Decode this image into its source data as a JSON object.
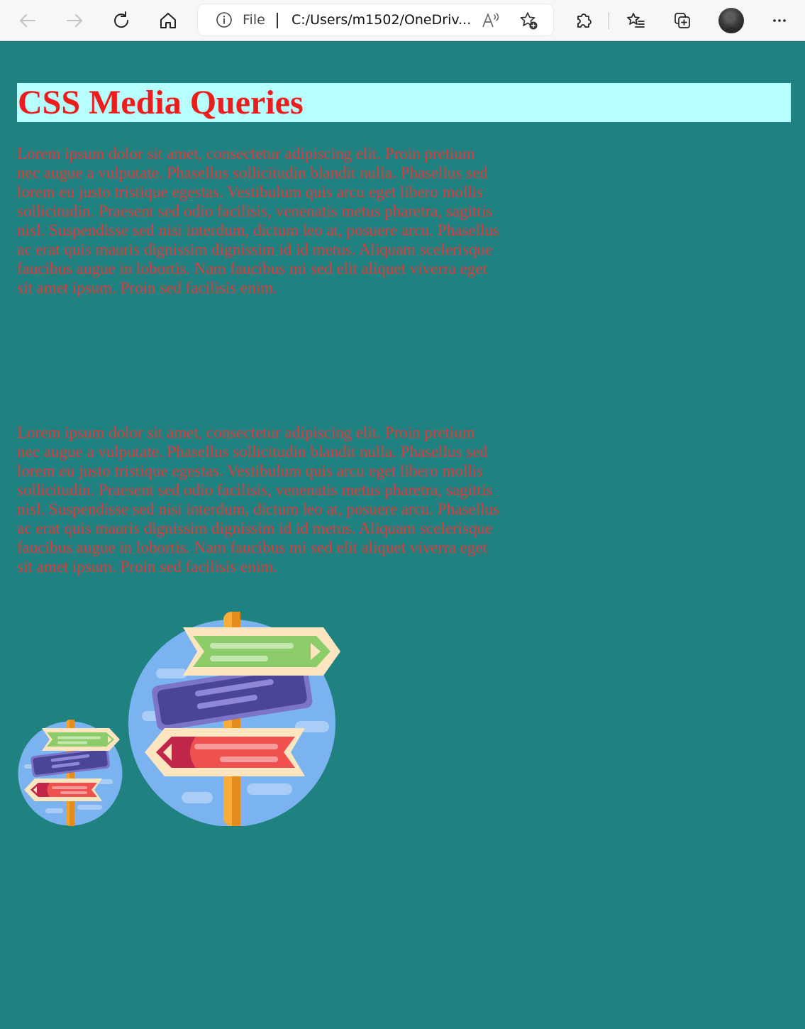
{
  "browser": {
    "icons": {
      "back": "arrow-left-icon",
      "forward": "arrow-right-icon",
      "refresh": "refresh-icon",
      "home": "home-icon",
      "site_info": "info-icon",
      "read_aloud": "read-aloud-icon",
      "add_favorite": "star-plus-icon",
      "extensions": "puzzle-icon",
      "favorites": "favorites-list-icon",
      "collections": "collections-icon",
      "more": "more-dots-icon"
    },
    "address": {
      "scheme_label": "File",
      "url": "C:/Users/m1502/OneDriv..."
    }
  },
  "page": {
    "heading": "CSS Media Queries",
    "paragraphs": [
      "Lorem ipsum dolor sit amet, consectetur adipiscing elit. Proin pretium nec augue a vulputate. Phasellus sollicitudin blandit nulla. Phasellus sed lorem eu justo tristique egestas. Vestibulum quis arcu eget libero mollis sollicitudin. Praesent sed odio facilisis, venenatis metus pharetra, sagittis nisl. Suspendisse sed nisi interdum, dictum leo at, posuere arcu. Phasellus ac erat quis mauris dignissim dignissim id id metus. Aliquam scelerisque faucibus augue in lobortis. Nam faucibus mi sed elit aliquet viverra eget sit amet ipsum. Proin sed facilisis enim.",
      "Lorem ipsum dolor sit amet, consectetur adipiscing elit. Proin pretium nec augue a vulputate. Phasellus sollicitudin blandit nulla. Phasellus sed lorem eu justo tristique egestas. Vestibulum quis arcu eget libero mollis sollicitudin. Praesent sed odio facilisis, venenatis metus pharetra, sagittis nisl. Suspendisse sed nisi interdum, dictum leo at, posuere arcu. Phasellus ac erat quis mauris dignissim dignissim id id metus. Aliquam scelerisque faucibus augue in lobortis. Nam faucibus mi sed elit aliquet viverra eget sit amet ipsum. Proin sed facilisis enim."
    ],
    "images": [
      "signpost-icon",
      "signpost-icon"
    ]
  },
  "colors": {
    "page_background": "#208181",
    "heading_background": "#b7ffff",
    "heading_text": "#ed1d1d",
    "paragraph_text": "#e03a3a"
  }
}
